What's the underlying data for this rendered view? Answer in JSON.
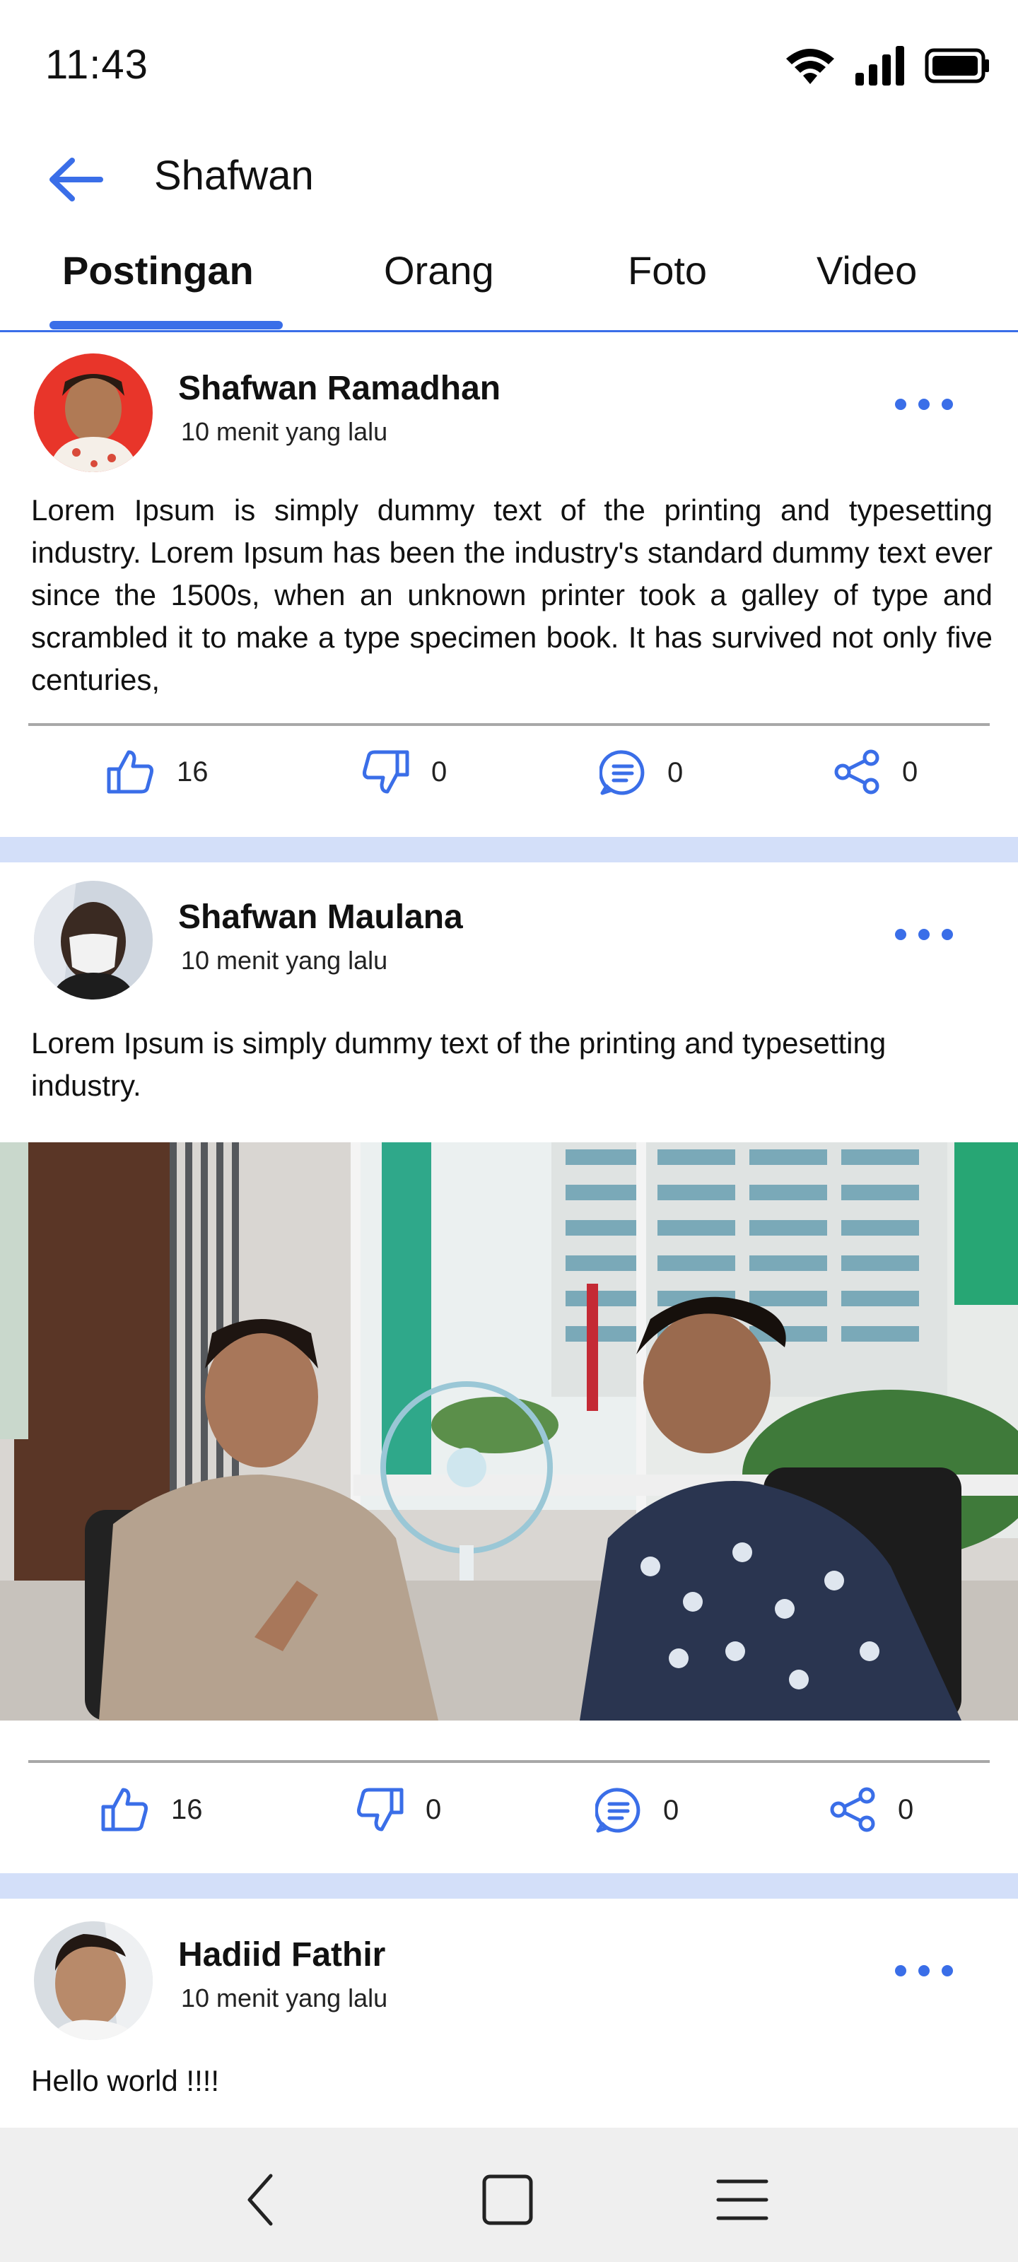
{
  "status_bar": {
    "time": "11:43",
    "icons": [
      "wifi-icon",
      "signal-icon",
      "battery-icon"
    ]
  },
  "app_bar": {
    "back_icon": "arrow-left-icon",
    "search_query": "Shafwan"
  },
  "tabs": [
    {
      "label": "Postingan",
      "active": true
    },
    {
      "label": "Orang",
      "active": false
    },
    {
      "label": "Foto",
      "active": false
    },
    {
      "label": "Video",
      "active": false
    }
  ],
  "posts": [
    {
      "author": "Shafwan Ramadhan",
      "time": "10 menit yang lalu",
      "text": "Lorem Ipsum is simply dummy text of the printing and typesetting industry. Lorem Ipsum has been the industry's standard dummy text ever since the 1500s, when an unknown printer took a galley of type and scrambled it to make a type specimen book. It has survived not only five centuries,",
      "likes": "16",
      "dislikes": "0",
      "comments": "0",
      "shares": "0"
    },
    {
      "author": "Shafwan Maulana",
      "time": "10 menit yang lalu",
      "text": "Lorem Ipsum is simply dummy text of the printing and typesetting industry.",
      "has_photo": true,
      "likes": "16",
      "dislikes": "0",
      "comments": "0",
      "shares": "0"
    },
    {
      "author": "Hadiid Fathir",
      "time": "10 menit yang lalu",
      "text": "Hello world !!!!"
    }
  ],
  "nav_bar": {
    "icons": [
      "back-nav-icon",
      "home-square-icon",
      "menu-lines-icon"
    ]
  },
  "colors": {
    "accent": "#3a6ee8",
    "separator": "#d3dff9",
    "nav_background": "#efefef"
  }
}
